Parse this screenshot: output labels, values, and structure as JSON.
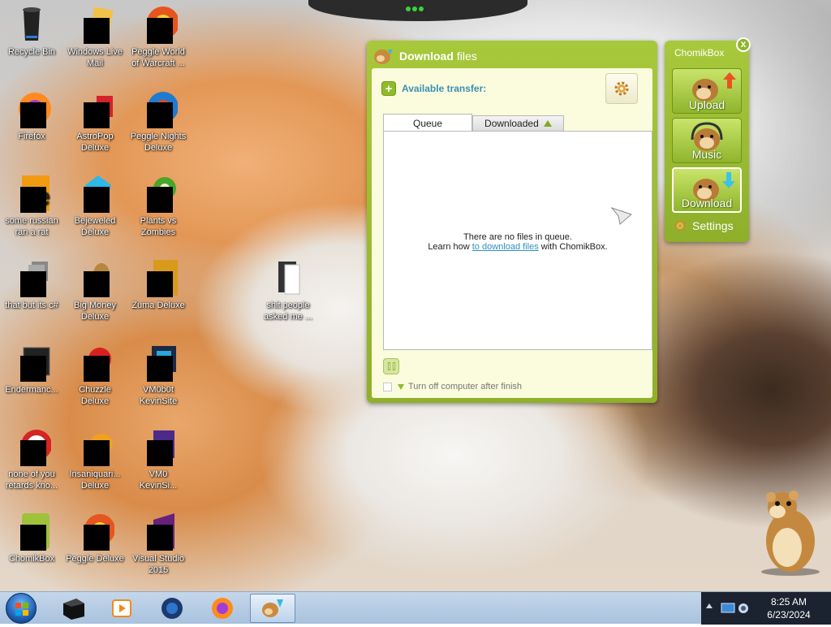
{
  "desktop": {
    "icons": [
      {
        "label": "Recycle Bin"
      },
      {
        "label": "Windows Live\nMail"
      },
      {
        "label": "Peggle World\nof Warcraft ..."
      },
      {
        "label": "Firefox"
      },
      {
        "label": "AstroPop\nDeluxe"
      },
      {
        "label": "Peggle Nights\nDeluxe"
      },
      {
        "label": "some russian\nran a rat"
      },
      {
        "label": "Bejeweled\nDeluxe"
      },
      {
        "label": "Plants vs\nZombies"
      },
      {
        "label": "that but its c#"
      },
      {
        "label": "Big Money\nDeluxe"
      },
      {
        "label": "Zuma Deluxe"
      },
      {
        "label": "shit people\nasked me ..."
      },
      {
        "label": "Endermanc..."
      },
      {
        "label": "Chuzzle\nDeluxe"
      },
      {
        "label": "VM0b0t\nKevinSite"
      },
      {
        "label": "none of you\nretards kno..."
      },
      {
        "label": "Insaniquari...\nDeluxe"
      },
      {
        "label": "VM0\nKevinSi..."
      },
      {
        "label": "ChomikBox"
      },
      {
        "label": "Peggle Deluxe"
      },
      {
        "label": "Visual Studio\n2015"
      }
    ]
  },
  "download_window": {
    "title_bold": "Download",
    "title_rest": "files",
    "available_transfer": "Available transfer:",
    "tabs": [
      {
        "label": "Queue"
      },
      {
        "label": "Downloaded"
      }
    ],
    "empty_message": "There are no files in queue.",
    "learn_prefix": "Learn how",
    "learn_link": "to download files",
    "learn_suffix": "with ChomikBox.",
    "shutdown_label": "Turn off computer after finish"
  },
  "chomikbox_panel": {
    "title": "ChomikBox",
    "close": "x",
    "buttons": [
      {
        "label": "Upload"
      },
      {
        "label": "Music"
      },
      {
        "label": "Download"
      }
    ],
    "settings_label": "Settings"
  },
  "taskbar": {
    "time": "8:25 AM",
    "date": "6/23/2024"
  },
  "colors": {
    "chomik_green": "#8fb02a",
    "link_blue": "#2e8fbf",
    "panel_bg": "#fbfbdd"
  }
}
